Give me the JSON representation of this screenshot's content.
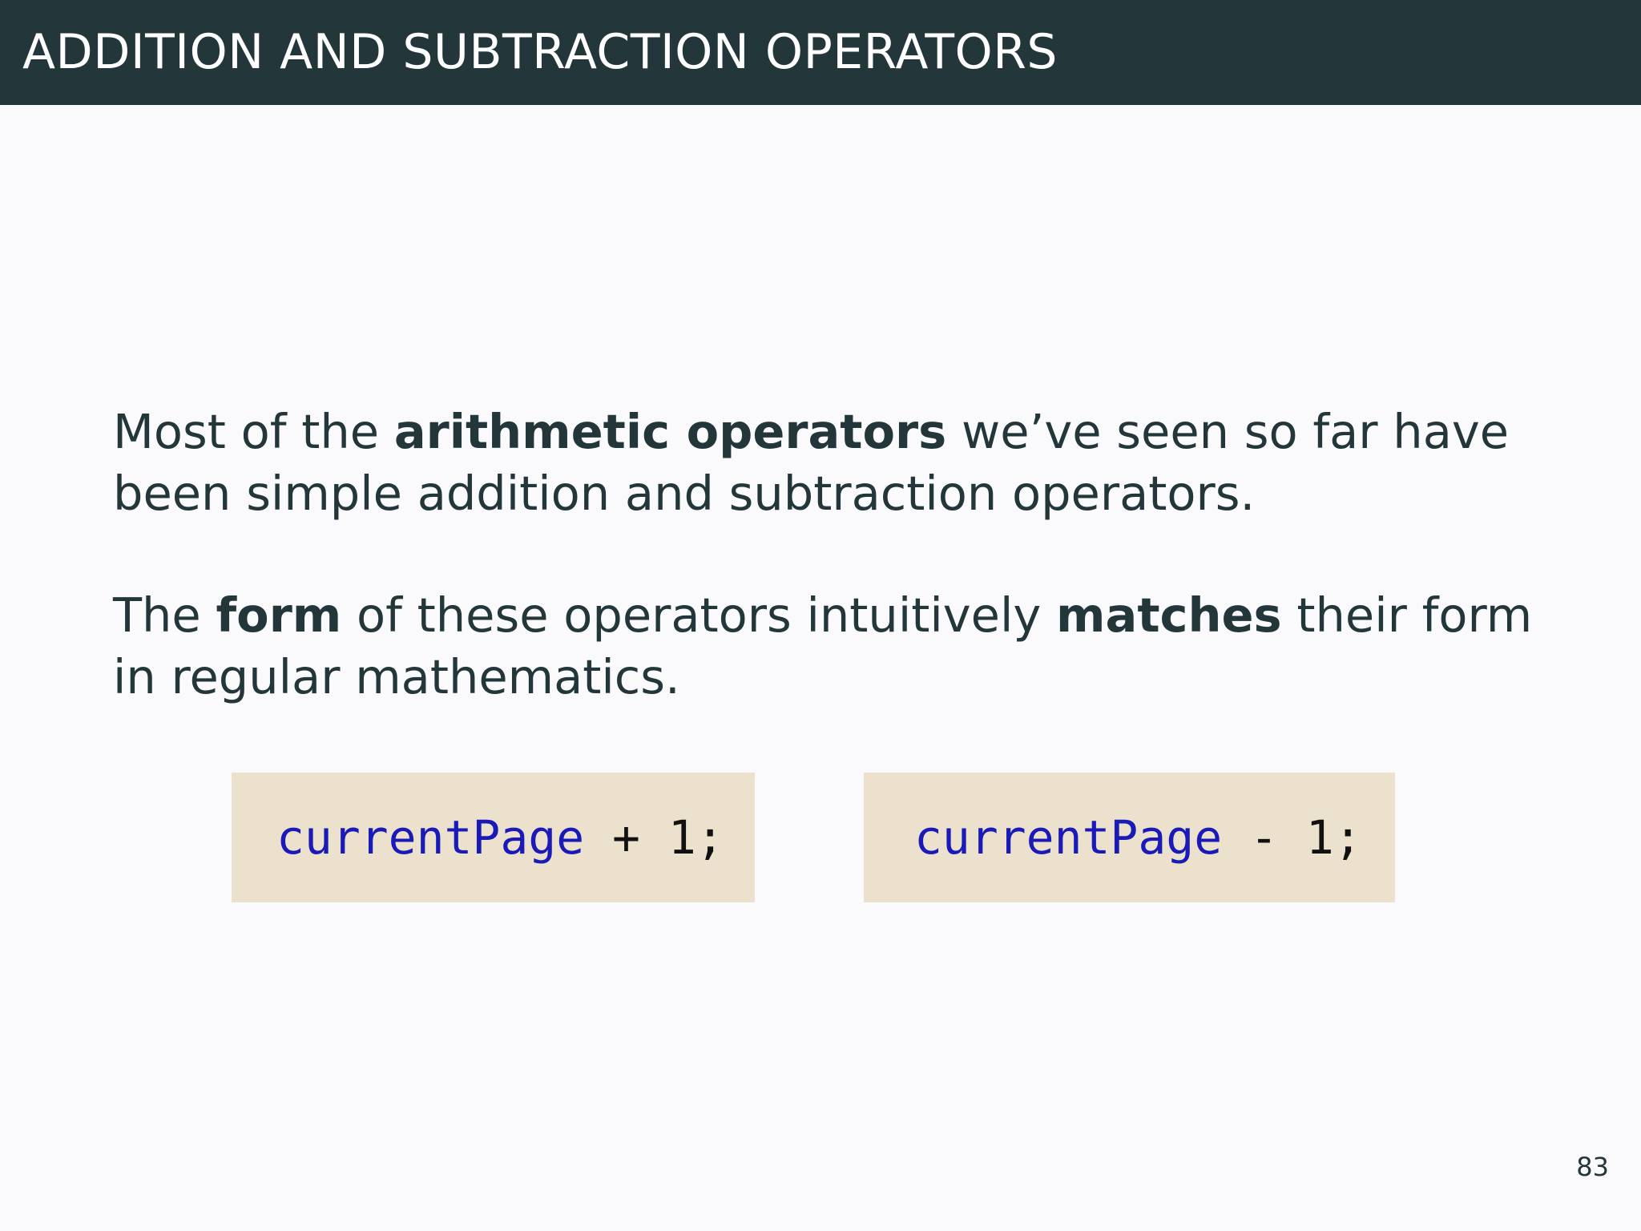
{
  "slide": {
    "title": "ADDITION AND SUBTRACTION OPERATORS",
    "page_number": "83"
  },
  "paragraph1": {
    "text_a": "Most of the ",
    "bold_a": "arithmetic operators",
    "text_b": " we’ve seen so far have been simple addition and subtraction operators."
  },
  "paragraph2": {
    "text_a": "The ",
    "bold_a": "form",
    "text_b": " of these operators intuitively ",
    "bold_b": "matches",
    "text_c": " their form in regular mathematics."
  },
  "code_examples": [
    {
      "identifier": "currentPage",
      "operator": " + ",
      "operand": "1;"
    },
    {
      "identifier": "currentPage",
      "operator": " - ",
      "operand": "1;"
    }
  ],
  "colors": {
    "header_background": "#23373b",
    "page_background": "#fafafc",
    "code_background": "#ece1cd",
    "code_identifier": "#1a1ab8",
    "text": "#23373b"
  }
}
